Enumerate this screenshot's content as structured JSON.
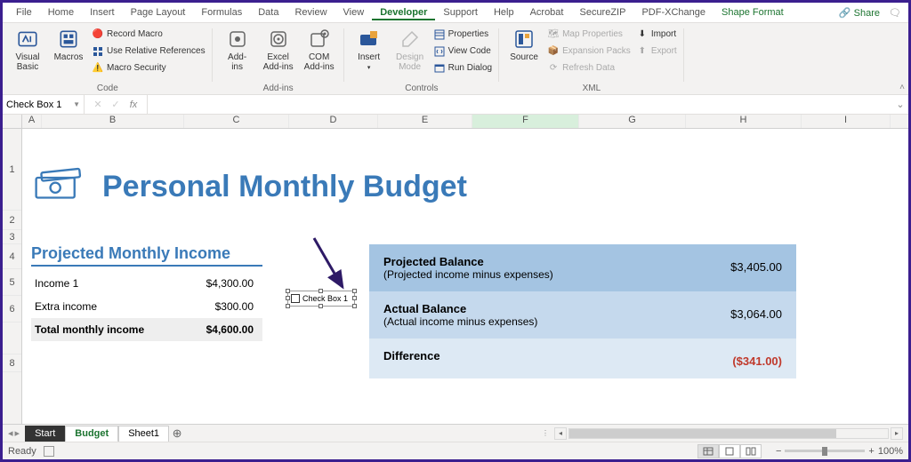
{
  "tabs": {
    "items": [
      "File",
      "Home",
      "Insert",
      "Page Layout",
      "Formulas",
      "Data",
      "Review",
      "View",
      "Developer",
      "Support",
      "Help",
      "Acrobat",
      "SecureZIP",
      "PDF-XChange",
      "Shape Format"
    ],
    "active_index": 8,
    "share": "Share",
    "comment_glyph": "💬"
  },
  "ribbon": {
    "code": {
      "visual_basic": "Visual\nBasic",
      "macros": "Macros",
      "record_macro": "Record Macro",
      "use_rel_refs": "Use Relative References",
      "macro_security": "Macro Security",
      "label": "Code"
    },
    "addins": {
      "addins": "Add-\nins",
      "excel_addins": "Excel\nAdd-ins",
      "com_addins": "COM\nAdd-ins",
      "label": "Add-ins"
    },
    "controls": {
      "insert": "Insert",
      "design_mode": "Design\nMode",
      "properties": "Properties",
      "view_code": "View Code",
      "run_dialog": "Run Dialog",
      "label": "Controls"
    },
    "xml": {
      "source": "Source",
      "map_props": "Map Properties",
      "expansion": "Expansion Packs",
      "refresh": "Refresh Data",
      "import": "Import",
      "export": "Export",
      "label": "XML"
    }
  },
  "namebox": "Check Box 1",
  "fx_label": "fx",
  "columns": [
    {
      "l": "A",
      "w": 22
    },
    {
      "l": "B",
      "w": 160
    },
    {
      "l": "C",
      "w": 118
    },
    {
      "l": "D",
      "w": 100
    },
    {
      "l": "E",
      "w": 106
    },
    {
      "l": "F",
      "w": 120
    },
    {
      "l": "G",
      "w": 120
    },
    {
      "l": "H",
      "w": 130
    },
    {
      "l": "I",
      "w": 100
    }
  ],
  "selected_col": "F",
  "rows": [
    {
      "l": "1",
      "h": 92
    },
    {
      "l": "2",
      "h": 22
    },
    {
      "l": "3",
      "h": 16
    },
    {
      "l": "4",
      "h": 28
    },
    {
      "l": "5",
      "h": 30
    },
    {
      "l": "6",
      "h": 30
    },
    {
      "l": "",
      "h": 36
    },
    {
      "l": "8",
      "h": 20
    }
  ],
  "content": {
    "title": "Personal Monthly Budget",
    "income_header": "Projected Monthly Income",
    "income": [
      {
        "label": "Income 1",
        "value": "$4,300.00"
      },
      {
        "label": "Extra income",
        "value": "$300.00"
      }
    ],
    "income_total_label": "Total monthly income",
    "income_total_value": "$4,600.00",
    "balance": [
      {
        "title": "Projected Balance",
        "sub": "(Projected income minus expenses)",
        "value": "$3,405.00",
        "cls": "r1"
      },
      {
        "title": "Actual Balance",
        "sub": "(Actual income minus expenses)",
        "value": "$3,064.00",
        "cls": "r2"
      },
      {
        "title": "Difference",
        "sub": "",
        "value": "($341.00)",
        "cls": "r3",
        "neg": true
      }
    ],
    "checkbox_label": "Check Box 1"
  },
  "sheet_tabs": {
    "tabs": [
      {
        "label": "Start",
        "cls": "dark"
      },
      {
        "label": "Budget",
        "cls": "active"
      },
      {
        "label": "Sheet1",
        "cls": ""
      }
    ],
    "add": "⊕"
  },
  "status": {
    "ready": "Ready",
    "zoom": "100%"
  }
}
